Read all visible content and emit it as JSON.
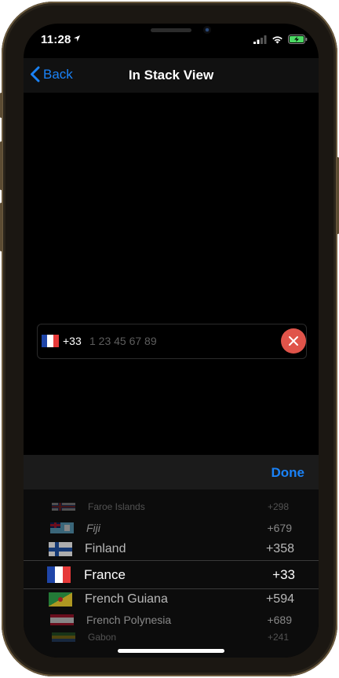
{
  "status_bar": {
    "time": "11:28",
    "icons": [
      "location-arrow-icon",
      "signal-icon",
      "wifi-icon",
      "battery-charging-icon"
    ],
    "battery_color": "#4cd964"
  },
  "nav": {
    "back_label": "Back",
    "title": "In Stack View",
    "accent_color": "#1a82f7"
  },
  "phone_field": {
    "flag": "France",
    "dial_code": "+33",
    "value": "",
    "placeholder": "1 23 45 67 89",
    "clear_button_color": "#e0544a"
  },
  "picker": {
    "done_label": "Done",
    "selected": "France",
    "rows": [
      {
        "name": "Faroe Islands",
        "code": "+298"
      },
      {
        "name": "Fiji",
        "code": "+679"
      },
      {
        "name": "Finland",
        "code": "+358"
      },
      {
        "name": "France",
        "code": "+33"
      },
      {
        "name": "French Guiana",
        "code": "+594"
      },
      {
        "name": "French Polynesia",
        "code": "+689"
      },
      {
        "name": "Gabon",
        "code": "+241"
      }
    ]
  }
}
